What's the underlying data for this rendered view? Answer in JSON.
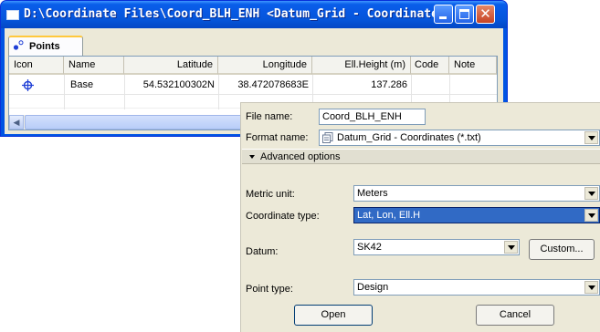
{
  "window": {
    "title": "D:\\Coordinate Files\\Coord_BLH_ENH  <Datum_Grid - Coordinates>"
  },
  "tab": {
    "label": "Points"
  },
  "table": {
    "columns": [
      "Icon",
      "Name",
      "Latitude",
      "Longitude",
      "Ell.Height (m)",
      "Code",
      "Note"
    ],
    "rows": [
      {
        "icon": "crosshair-point-icon",
        "name": "Base",
        "latitude": "54.532100302N",
        "longitude": "38.472078683E",
        "height": "137.286",
        "code": "",
        "note": ""
      }
    ]
  },
  "dialog": {
    "file_name_label": "File name:",
    "file_name_value": "Coord_BLH_ENH",
    "format_name_label": "Format name:",
    "format_name_value": "Datum_Grid - Coordinates (*.txt)",
    "advanced_label": "Advanced options",
    "metric_unit_label": "Metric unit:",
    "metric_unit_value": "Meters",
    "coordinate_type_label": "Coordinate type:",
    "coordinate_type_value": "Lat, Lon, Ell.H",
    "datum_label": "Datum:",
    "datum_value": "SK42",
    "custom_button": "Custom...",
    "point_type_label": "Point type:",
    "point_type_value": "Design",
    "open_button": "Open",
    "cancel_button": "Cancel"
  },
  "colors": {
    "title_bar": "#0555d9",
    "selection": "#316ac5",
    "point_icon": "#1f3fd6"
  }
}
